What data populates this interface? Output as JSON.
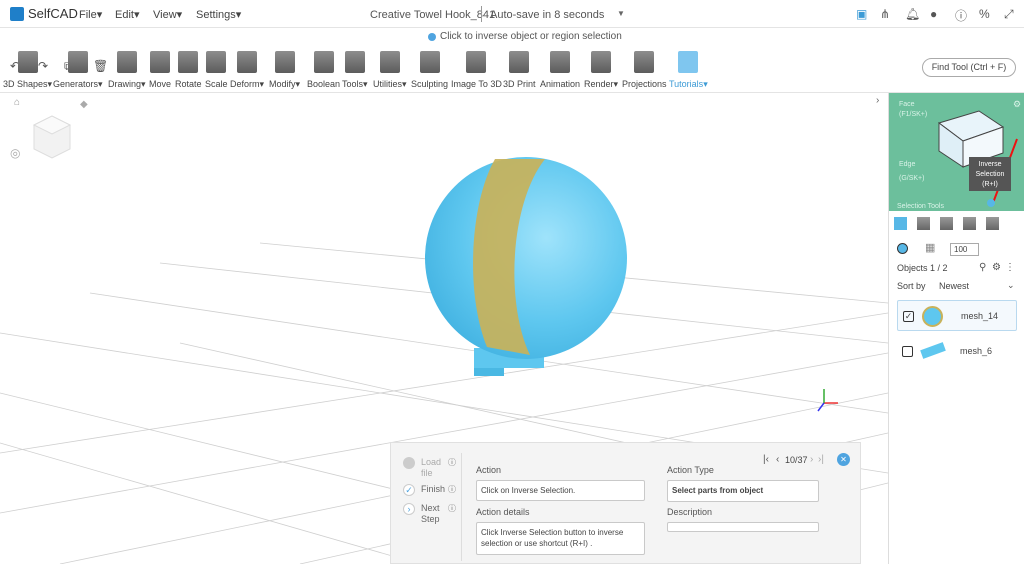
{
  "app": {
    "name": "SelfCAD"
  },
  "menu": [
    "File",
    "Edit",
    "View",
    "Settings"
  ],
  "document": {
    "title": "Creative Towel Hook_841",
    "autosave": "Auto-save in 8 seconds"
  },
  "hint": "Click to inverse object or region selection",
  "toolbar": [
    {
      "label": "3D Shapes",
      "dd": true
    },
    {
      "label": "Generators",
      "dd": true
    },
    {
      "label": "Drawing",
      "dd": true
    },
    {
      "label": "Move",
      "dd": false
    },
    {
      "label": "Rotate",
      "dd": false
    },
    {
      "label": "Scale",
      "dd": false
    },
    {
      "label": "Deform",
      "dd": true
    },
    {
      "label": "Modify",
      "dd": true
    },
    {
      "label": "Boolean",
      "dd": false
    },
    {
      "label": "Tools",
      "dd": true
    },
    {
      "label": "Utilities",
      "dd": true
    },
    {
      "label": "Sculpting",
      "dd": false
    },
    {
      "label": "Image To 3D",
      "dd": false
    },
    {
      "label": "3D Print",
      "dd": false
    },
    {
      "label": "Animation",
      "dd": false
    },
    {
      "label": "Render",
      "dd": true
    },
    {
      "label": "Projections",
      "dd": false
    },
    {
      "label": "Tutorials",
      "dd": true
    }
  ],
  "find_tool": "Find Tool (Ctrl + F)",
  "right_panel": {
    "cube_labels": {
      "face": "Face",
      "face_sub": "(F1/SK+)",
      "edge": "Edge",
      "edge_sub": "(G/SK+)",
      "sel_tools": "Selection Tools"
    },
    "tooltip": [
      "Inverse",
      "Selection",
      "(R+I)"
    ],
    "opacity": "100",
    "objects_count": "Objects 1 / 2",
    "sort_label": "Sort by",
    "sort_value": "Newest",
    "objects": [
      {
        "name": "mesh_14",
        "checked": true
      },
      {
        "name": "mesh_6",
        "checked": false
      }
    ]
  },
  "tutorial": {
    "steps": [
      {
        "label": "Load file"
      },
      {
        "label": "Finish"
      },
      {
        "label": "Next Step"
      }
    ],
    "counter": "10/37",
    "action_label": "Action",
    "action_value": "Click on Inverse Selection.",
    "action_type_label": "Action Type",
    "action_type_value": "Select parts from object",
    "details_label": "Action details",
    "details_value": "Click Inverse Selection button to inverse selection or use shortcut  (R+I) .",
    "description_label": "Description",
    "description_value": ""
  },
  "colors": {
    "accent": "#4fa4e0",
    "sphere": "#5ec7ef",
    "band": "#c8b25a",
    "cube_bg": "#6cbf9c"
  }
}
